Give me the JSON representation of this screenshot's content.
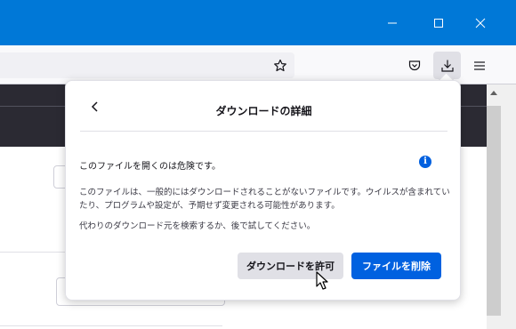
{
  "window": {
    "controls": [
      "minimize",
      "maximize",
      "close"
    ]
  },
  "toolbar": {
    "icons": [
      "bookmark-star-icon",
      "pocket-icon",
      "downloads-icon",
      "hamburger-menu-icon"
    ]
  },
  "panel": {
    "title": "ダウンロードの詳細",
    "warning": "このファイルを開くのは危険です。",
    "info_glyph": "i",
    "description": "このファイルは、一般的にはダウンロードされることがないファイルです。ウイルスが含まれていたり、プログラムや設定が、予期せず変更される可能性があります。",
    "suggestion": "代わりのダウンロード元を検索するか、後で試してください。",
    "buttons": {
      "allow": "ダウンロードを許可",
      "delete": "ファイルを削除"
    }
  },
  "colors": {
    "titlebar": "#0078d7",
    "primary_button": "#0061e0",
    "secondary_button": "#e0e0e6",
    "info": "#0060df"
  }
}
